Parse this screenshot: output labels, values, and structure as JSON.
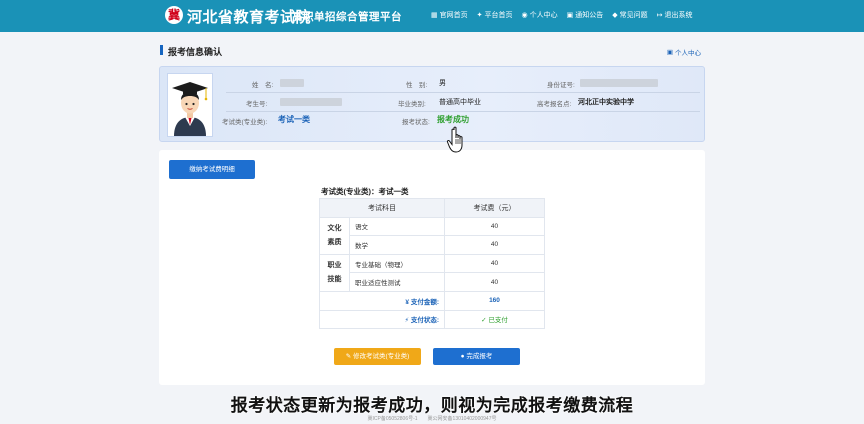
{
  "header": {
    "logo_glyph": "冀",
    "title": "河北省教育考试院",
    "subtitle": "高职单招综合管理平台",
    "nav": [
      {
        "icon": "home-icon",
        "glyph": "▦",
        "label": "官网首页"
      },
      {
        "icon": "platform-icon",
        "glyph": "✦",
        "label": "平台首页"
      },
      {
        "icon": "user-icon",
        "glyph": "◉",
        "label": "个人中心"
      },
      {
        "icon": "notice-icon",
        "glyph": "▣",
        "label": "通知公告"
      },
      {
        "icon": "faq-icon",
        "glyph": "◆",
        "label": "常见问题"
      },
      {
        "icon": "logout-icon",
        "glyph": "↦",
        "label": "退出系统"
      }
    ]
  },
  "page": {
    "title": "报考信息确认",
    "personal_center_link": "个人中心"
  },
  "info": {
    "name_label": "姓　名:",
    "gender_label": "性　别:",
    "gender": "男",
    "id_label": "身份证号:",
    "exam_no_label": "考生号:",
    "grad_type_label": "毕业类别:",
    "grad_type": "普通高中毕业",
    "reg_point_label": "高考报名点:",
    "reg_point": "河北正中实验中学",
    "exam_type_label": "考试类(专业类):",
    "exam_type": "考试一类",
    "status_label": "报考状态:",
    "status": "报考成功"
  },
  "content": {
    "detail_button": "缴纳考试费明细",
    "table_caption": "考试类(专业类)：考试一类",
    "col_subject": "考试科目",
    "col_fee": "考试费（元）",
    "groups": [
      {
        "category": "文化素质",
        "items": [
          {
            "subject": "语文",
            "fee": "40"
          },
          {
            "subject": "数学",
            "fee": "40"
          }
        ]
      },
      {
        "category": "职业技能",
        "items": [
          {
            "subject": "专业基础（物理）",
            "fee": "40"
          },
          {
            "subject": "职业适应性测试",
            "fee": "40"
          }
        ]
      }
    ],
    "total_label": "¥ 支付金额:",
    "total_value": "160",
    "pay_status_label": "⚡ 支付状态:",
    "pay_status_value": "✓ 已支付",
    "edit_button": "修改考试类(专业类)",
    "finish_button": "完成报考",
    "edit_icon": "edit-icon",
    "finish_icon": "check-circle-icon"
  },
  "caption": "报考状态更新为报考成功，则视为完成报考缴费流程",
  "footer": "冀ICP备05052806号-1　　冀公网安备13010402000947号"
}
